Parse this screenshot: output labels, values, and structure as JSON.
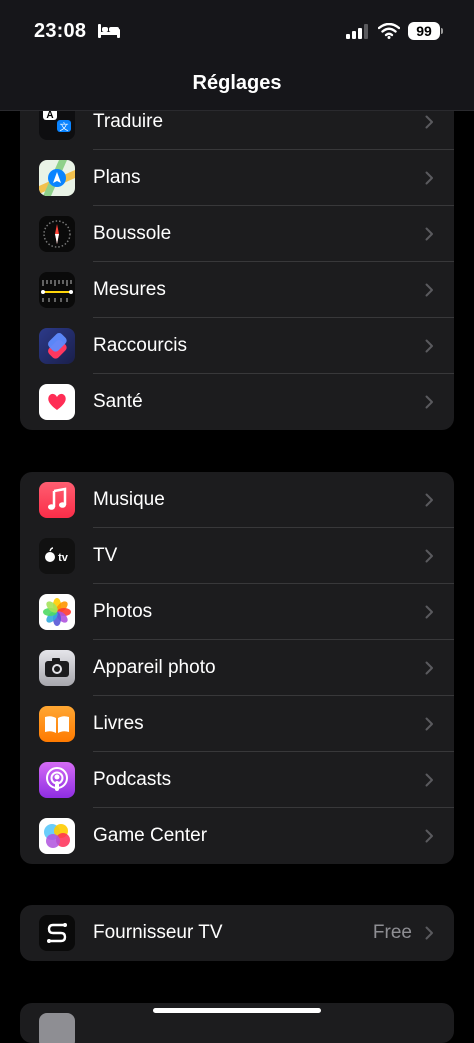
{
  "status": {
    "time": "23:08",
    "battery": "99"
  },
  "nav": {
    "title": "Réglages"
  },
  "group1": [
    {
      "label": "Traduire",
      "icon": "translate-icon"
    },
    {
      "label": "Plans",
      "icon": "maps-icon"
    },
    {
      "label": "Boussole",
      "icon": "compass-icon"
    },
    {
      "label": "Mesures",
      "icon": "measure-icon"
    },
    {
      "label": "Raccourcis",
      "icon": "shortcuts-icon"
    },
    {
      "label": "Santé",
      "icon": "health-icon"
    }
  ],
  "group2": [
    {
      "label": "Musique",
      "icon": "music-icon"
    },
    {
      "label": "TV",
      "icon": "tv-icon"
    },
    {
      "label": "Photos",
      "icon": "photos-icon"
    },
    {
      "label": "Appareil photo",
      "icon": "camera-icon"
    },
    {
      "label": "Livres",
      "icon": "books-icon"
    },
    {
      "label": "Podcasts",
      "icon": "podcasts-icon"
    },
    {
      "label": "Game Center",
      "icon": "game-center-icon"
    }
  ],
  "group3": [
    {
      "label": "Fournisseur TV",
      "value": "Free",
      "icon": "tv-provider-icon"
    }
  ],
  "colors": {
    "background": "#000000",
    "cell": "#1c1c1e",
    "separator": "#38383a",
    "secondary_text": "#8e8e93"
  }
}
